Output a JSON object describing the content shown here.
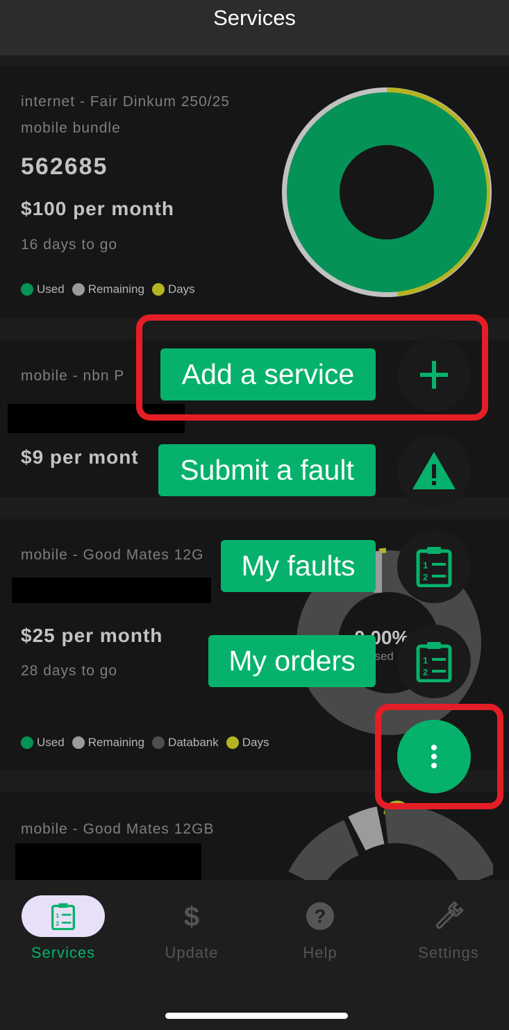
{
  "header": {
    "title": "Services"
  },
  "services": [
    {
      "subtitle_line1": "internet - Fair Dinkum 250/25",
      "subtitle_line2": "mobile bundle",
      "number": "562685",
      "price": "$100 per month",
      "days_left": "16 days to go",
      "legend": [
        "Used",
        "Remaining",
        "Days"
      ]
    },
    {
      "subtitle": "mobile - nbn P",
      "price": "$9 per mont"
    },
    {
      "subtitle": "mobile - Good Mates 12G",
      "price": "$25 per month",
      "days_left": "28 days to go",
      "usage_percent": "0.00%",
      "usage_label": "used",
      "legend": [
        "Used",
        "Remaining",
        "Databank",
        "Days"
      ]
    },
    {
      "subtitle": "mobile - Good Mates 12GB"
    }
  ],
  "fab_menu": {
    "add_service": "Add a service",
    "submit_fault": "Submit a fault",
    "my_faults": "My faults",
    "my_orders": "My orders"
  },
  "nav": {
    "services": "Services",
    "update": "Update",
    "help": "Help",
    "settings": "Settings"
  },
  "colors": {
    "accent_green": "#06b26b",
    "yellow": "#dcdc2a",
    "annotation_red": "#e41e26",
    "nav_active_bg": "#e8e0f8"
  }
}
